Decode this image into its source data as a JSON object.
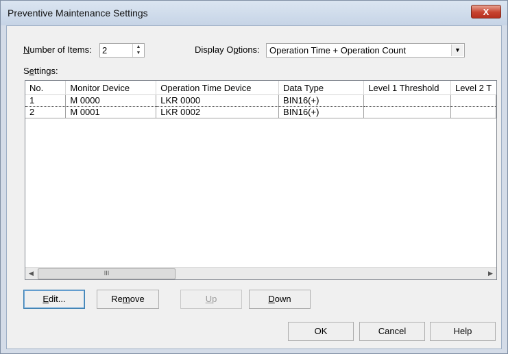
{
  "window": {
    "title": "Preventive Maintenance Settings",
    "close_symbol": "X"
  },
  "number_of_items": {
    "label_mnemonic": "N",
    "label_rest": "umber of Items:",
    "value": "2"
  },
  "display_options": {
    "label_pre": "Display O",
    "label_mnemonic": "p",
    "label_post": "tions:",
    "value": "Operation Time + Operation Count"
  },
  "settings_label": {
    "pre": "S",
    "mnemonic": "e",
    "post": "ttings:"
  },
  "table": {
    "columns": [
      "No.",
      "Monitor Device",
      "Operation Time Device",
      "Data Type",
      "Level 1 Threshold",
      "Level 2 T"
    ],
    "rows": [
      [
        "1",
        "M 0000",
        "LKR 0000",
        "BIN16(+)",
        "",
        ""
      ],
      [
        "2",
        "M 0001",
        "LKR 0002",
        "BIN16(+)",
        "",
        ""
      ]
    ],
    "scroll_thumb_glyph": "III"
  },
  "buttons": {
    "edit": {
      "mnemonic": "E",
      "rest": "dit..."
    },
    "remove": {
      "pre": "Re",
      "mnemonic": "m",
      "post": "ove"
    },
    "up": {
      "mnemonic": "U",
      "rest": "p"
    },
    "down": {
      "mnemonic": "D",
      "rest": "own"
    },
    "ok": "OK",
    "cancel": "Cancel",
    "help": "Help"
  }
}
